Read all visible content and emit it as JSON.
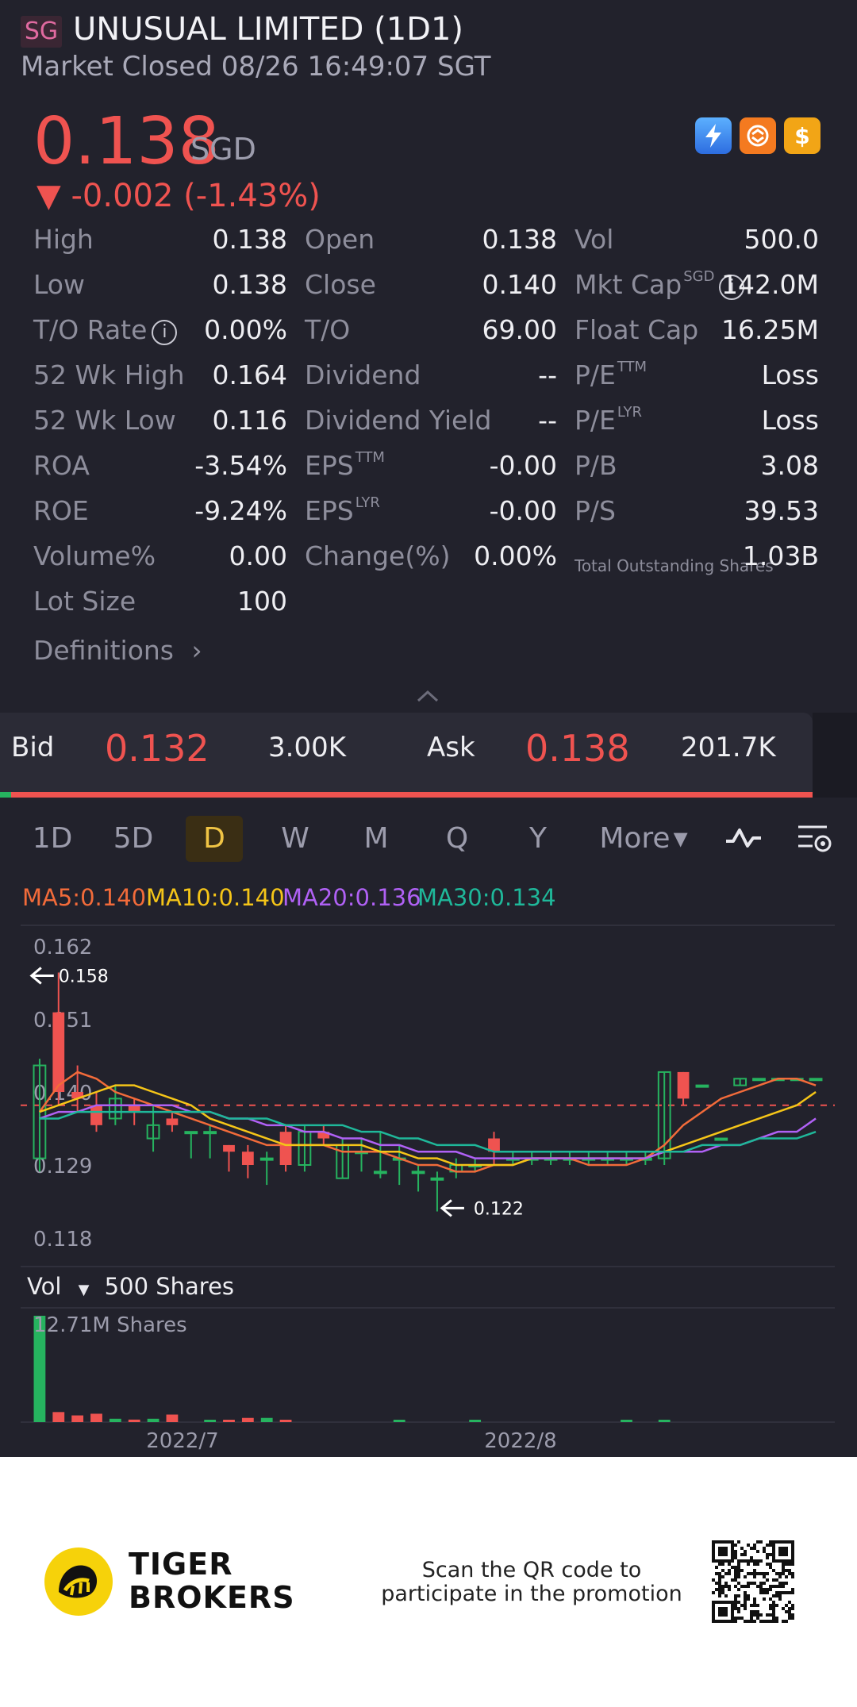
{
  "header": {
    "market_badge": "SG",
    "title": "UNUSUAL LIMITED (1D1)",
    "status": "Market Closed 08/26 16:49:07 SGT"
  },
  "quote": {
    "price": "0.138",
    "currency": "SGD",
    "change": "▼ -0.002 (-1.43%)",
    "colors": {
      "down": "#ef5350",
      "up": "#26b35f"
    }
  },
  "stats": {
    "c1": [
      {
        "label": "High",
        "value": "0.138"
      },
      {
        "label": "Low",
        "value": "0.138"
      },
      {
        "label": "T/O Rate",
        "value": "0.00%"
      },
      {
        "label": "52 Wk High",
        "value": "0.164"
      },
      {
        "label": "52 Wk Low",
        "value": "0.116"
      },
      {
        "label": "ROA",
        "value": "-3.54%"
      },
      {
        "label": "ROE",
        "value": "-9.24%"
      },
      {
        "label": "Volume%",
        "value": "0.00"
      },
      {
        "label": "Lot Size",
        "value": "100"
      }
    ],
    "c2": [
      {
        "label": "Open",
        "value": "0.138"
      },
      {
        "label": "Close",
        "value": "0.140"
      },
      {
        "label": "T/O",
        "value": "69.00"
      },
      {
        "label": "Dividend",
        "value": "--"
      },
      {
        "label": "Dividend Yield",
        "value": "--"
      },
      {
        "label": "EPS",
        "sup": "TTM",
        "value": "-0.00"
      },
      {
        "label": "EPS",
        "sup": "LYR",
        "value": "-0.00"
      },
      {
        "label": "Change(%)",
        "value": "0.00%"
      }
    ],
    "c3": [
      {
        "label": "Vol",
        "value": "500.0"
      },
      {
        "label": "Mkt Cap",
        "sup": "SGD",
        "value": "142.0M"
      },
      {
        "label": "Float Cap",
        "value": "16.25M"
      },
      {
        "label": "P/E",
        "sup": "TTM",
        "value": "Loss"
      },
      {
        "label": "P/E",
        "sup": "LYR",
        "value": "Loss"
      },
      {
        "label": "P/B",
        "value": "3.08"
      },
      {
        "label": "P/S",
        "value": "39.53"
      },
      {
        "label": "Total Outstanding Shares",
        "value": "1.03B"
      }
    ],
    "definitions": "Definitions"
  },
  "orderbook": {
    "bid_label": "Bid",
    "bid_price": "0.132",
    "bid_size": "3.00K",
    "ask_label": "Ask",
    "ask_price": "0.138",
    "ask_size": "201.7K"
  },
  "tabs": [
    "1D",
    "5D",
    "D",
    "W",
    "M",
    "Q",
    "Y",
    "More"
  ],
  "active_tab": "D",
  "ma": [
    {
      "label": "MA5:0.140",
      "color": "#f26b3a"
    },
    {
      "label": "MA10:0.140",
      "color": "#f5c518"
    },
    {
      "label": "MA20:0.136",
      "color": "#b061f5"
    },
    {
      "label": "MA30:0.134",
      "color": "#1fb89a"
    }
  ],
  "chart_data": {
    "type": "candlestick",
    "y_ticks": [
      "0.162",
      "0.151",
      "0.140",
      "0.129",
      "0.118"
    ],
    "ylim": [
      0.118,
      0.162
    ],
    "x_labels": [
      "2022/7",
      "2022/8"
    ],
    "high_marker": "0.158",
    "low_marker": "0.122",
    "last_close": 0.138,
    "candles": [
      {
        "o": 0.13,
        "h": 0.145,
        "l": 0.128,
        "c": 0.144
      },
      {
        "o": 0.152,
        "h": 0.158,
        "l": 0.138,
        "c": 0.14
      },
      {
        "o": 0.14,
        "h": 0.144,
        "l": 0.137,
        "c": 0.139
      },
      {
        "o": 0.138,
        "h": 0.14,
        "l": 0.134,
        "c": 0.135
      },
      {
        "o": 0.136,
        "h": 0.141,
        "l": 0.135,
        "c": 0.139
      },
      {
        "o": 0.138,
        "h": 0.139,
        "l": 0.135,
        "c": 0.137
      },
      {
        "o": 0.133,
        "h": 0.138,
        "l": 0.131,
        "c": 0.135
      },
      {
        "o": 0.136,
        "h": 0.137,
        "l": 0.134,
        "c": 0.135
      },
      {
        "o": 0.134,
        "h": 0.134,
        "l": 0.13,
        "c": 0.134
      },
      {
        "o": 0.134,
        "h": 0.135,
        "l": 0.13,
        "c": 0.134
      },
      {
        "o": 0.132,
        "h": 0.132,
        "l": 0.128,
        "c": 0.131
      },
      {
        "o": 0.131,
        "h": 0.132,
        "l": 0.127,
        "c": 0.129
      },
      {
        "o": 0.13,
        "h": 0.131,
        "l": 0.126,
        "c": 0.13
      },
      {
        "o": 0.134,
        "h": 0.135,
        "l": 0.128,
        "c": 0.129
      },
      {
        "o": 0.129,
        "h": 0.135,
        "l": 0.128,
        "c": 0.134
      },
      {
        "o": 0.134,
        "h": 0.135,
        "l": 0.132,
        "c": 0.133
      },
      {
        "o": 0.127,
        "h": 0.133,
        "l": 0.127,
        "c": 0.132
      },
      {
        "o": 0.131,
        "h": 0.133,
        "l": 0.128,
        "c": 0.131
      },
      {
        "o": 0.128,
        "h": 0.134,
        "l": 0.127,
        "c": 0.128
      },
      {
        "o": 0.13,
        "h": 0.132,
        "l": 0.126,
        "c": 0.13
      },
      {
        "o": 0.128,
        "h": 0.129,
        "l": 0.125,
        "c": 0.128
      },
      {
        "o": 0.127,
        "h": 0.128,
        "l": 0.122,
        "c": 0.127
      },
      {
        "o": 0.128,
        "h": 0.13,
        "l": 0.127,
        "c": 0.129
      },
      {
        "o": 0.129,
        "h": 0.13,
        "l": 0.128,
        "c": 0.129
      },
      {
        "o": 0.133,
        "h": 0.134,
        "l": 0.129,
        "c": 0.131
      },
      {
        "o": 0.13,
        "h": 0.131,
        "l": 0.129,
        "c": 0.13
      },
      {
        "o": 0.13,
        "h": 0.131,
        "l": 0.129,
        "c": 0.13
      },
      {
        "o": 0.13,
        "h": 0.131,
        "l": 0.129,
        "c": 0.13
      },
      {
        "o": 0.13,
        "h": 0.131,
        "l": 0.129,
        "c": 0.13
      },
      {
        "o": 0.13,
        "h": 0.131,
        "l": 0.129,
        "c": 0.13
      },
      {
        "o": 0.13,
        "h": 0.131,
        "l": 0.129,
        "c": 0.13
      },
      {
        "o": 0.13,
        "h": 0.131,
        "l": 0.129,
        "c": 0.13
      },
      {
        "o": 0.13,
        "h": 0.131,
        "l": 0.129,
        "c": 0.13
      },
      {
        "o": 0.13,
        "h": 0.143,
        "l": 0.129,
        "c": 0.143
      },
      {
        "o": 0.143,
        "h": 0.143,
        "l": 0.138,
        "c": 0.139
      },
      {
        "o": 0.141,
        "h": 0.141,
        "l": 0.141,
        "c": 0.141
      },
      {
        "o": 0.133,
        "h": 0.133,
        "l": 0.133,
        "c": 0.133
      },
      {
        "o": 0.141,
        "h": 0.142,
        "l": 0.141,
        "c": 0.142
      },
      {
        "o": 0.142,
        "h": 0.142,
        "l": 0.142,
        "c": 0.142
      },
      {
        "o": 0.142,
        "h": 0.142,
        "l": 0.142,
        "c": 0.142
      },
      {
        "o": 0.142,
        "h": 0.142,
        "l": 0.142,
        "c": 0.142
      },
      {
        "o": 0.142,
        "h": 0.142,
        "l": 0.142,
        "c": 0.142
      }
    ],
    "ma_lines": {
      "MA5": [
        0.137,
        0.141,
        0.143,
        0.142,
        0.14,
        0.139,
        0.138,
        0.137,
        0.136,
        0.135,
        0.134,
        0.133,
        0.132,
        0.132,
        0.132,
        0.132,
        0.131,
        0.131,
        0.131,
        0.13,
        0.129,
        0.129,
        0.128,
        0.128,
        0.129,
        0.129,
        0.13,
        0.13,
        0.13,
        0.129,
        0.129,
        0.129,
        0.13,
        0.132,
        0.135,
        0.137,
        0.139,
        0.14,
        0.141,
        0.142,
        0.142,
        0.141
      ],
      "MA10": [
        0.137,
        0.138,
        0.139,
        0.14,
        0.141,
        0.141,
        0.14,
        0.139,
        0.138,
        0.136,
        0.135,
        0.134,
        0.133,
        0.132,
        0.132,
        0.132,
        0.132,
        0.132,
        0.131,
        0.131,
        0.13,
        0.13,
        0.129,
        0.129,
        0.129,
        0.129,
        0.13,
        0.13,
        0.13,
        0.13,
        0.13,
        0.13,
        0.13,
        0.131,
        0.132,
        0.133,
        0.134,
        0.135,
        0.136,
        0.137,
        0.138,
        0.14
      ],
      "MA20": [
        0.136,
        0.137,
        0.137,
        0.138,
        0.138,
        0.138,
        0.138,
        0.138,
        0.137,
        0.137,
        0.136,
        0.136,
        0.135,
        0.135,
        0.134,
        0.134,
        0.133,
        0.133,
        0.132,
        0.132,
        0.131,
        0.131,
        0.131,
        0.13,
        0.13,
        0.13,
        0.13,
        0.13,
        0.13,
        0.13,
        0.13,
        0.13,
        0.13,
        0.131,
        0.131,
        0.131,
        0.132,
        0.132,
        0.133,
        0.134,
        0.134,
        0.136
      ],
      "MA30": [
        0.136,
        0.136,
        0.137,
        0.137,
        0.137,
        0.137,
        0.137,
        0.137,
        0.137,
        0.137,
        0.136,
        0.136,
        0.136,
        0.135,
        0.135,
        0.135,
        0.135,
        0.134,
        0.134,
        0.133,
        0.133,
        0.132,
        0.132,
        0.132,
        0.131,
        0.131,
        0.131,
        0.131,
        0.131,
        0.131,
        0.131,
        0.131,
        0.131,
        0.131,
        0.131,
        0.132,
        0.132,
        0.132,
        0.133,
        0.133,
        0.133,
        0.134
      ]
    },
    "volume_label": "Vol",
    "volume_value": "500 Shares",
    "volume_max_label": "12.71M Shares",
    "volume": [
      12.71,
      1.2,
      0.8,
      1.0,
      0.4,
      0.3,
      0.4,
      0.9,
      0,
      0.25,
      0.1,
      0.5,
      0.5,
      0.15,
      0,
      0,
      0,
      0,
      0,
      0.05,
      0,
      0,
      0,
      0.05,
      0,
      0,
      0,
      0,
      0,
      0,
      0,
      0.05,
      0,
      0.1,
      0,
      0,
      0,
      0,
      0,
      0,
      0,
      0
    ]
  },
  "footer": {
    "brand_line1": "TIGER",
    "brand_line2": "BROKERS",
    "scan_line1": "Scan the QR code to",
    "scan_line2": "participate in the promotion"
  }
}
